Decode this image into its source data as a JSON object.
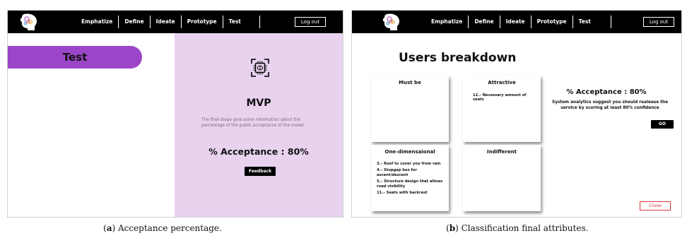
{
  "nav_items": [
    "Emphatize",
    "Define",
    "Ideate",
    "Prototype",
    "Test"
  ],
  "logout_label": "Log out",
  "panel_a": {
    "section_title": "Test",
    "mvp_icon": "brain-chip-icon",
    "mvp_title": "MVP",
    "description": "The final stage give some information about the percentage of the public acceptance of the model",
    "acceptance": "% Acceptance : 80%",
    "feedback_label": "Feedback"
  },
  "panel_b": {
    "title": "Users breakdown",
    "cards": {
      "must_be": {
        "title": "Must be",
        "items": []
      },
      "attractive": {
        "title": "Attractive",
        "items": [
          "12.– Necessary amount of seats"
        ]
      },
      "one_dimensional": {
        "title": "One-dimensaional",
        "items": [
          "3.– Roof to cover you from rain",
          "4.– Stopgap bus for ascent/descent",
          "5.– Structure design that allows road visibility",
          "11.– Seats with backrest"
        ]
      },
      "indifferent": {
        "title": "Indifferent",
        "items": []
      }
    },
    "acceptance": "% Acceptance : 80%",
    "analytics": "System analytics suggest you should realease the service by scoring at least 80% confidence",
    "go_label": "GO",
    "close_label": "Close"
  },
  "captions": {
    "a_label": "a",
    "a_text": "Acceptance percentage.",
    "b_label": "b",
    "b_text": "Classification final attributes."
  },
  "colors": {
    "topbar": "#000000",
    "pill": "#9b46c9",
    "lilac_panel": "#e8d2ee",
    "close_red": "#d63a3a"
  }
}
